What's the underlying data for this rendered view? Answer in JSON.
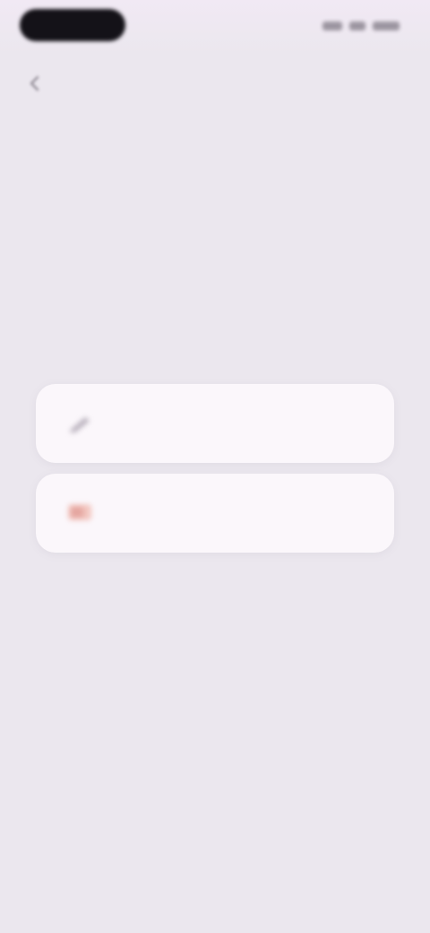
{
  "status_bar": {
    "icons": [
      "signal-icon",
      "wifi-icon",
      "battery-icon"
    ]
  },
  "header": {
    "back_icon": "back-arrow-icon"
  },
  "title": "",
  "options": [
    {
      "label": "",
      "icon": "pencil-icon",
      "icon_color": "#b8b0bc"
    },
    {
      "label": "",
      "icon": "flag-icon",
      "icon_color": "#e5a6a0"
    }
  ],
  "colors": {
    "background": "#ebe7ee",
    "card": "#fbf7fb",
    "status_pill": "#141218"
  }
}
